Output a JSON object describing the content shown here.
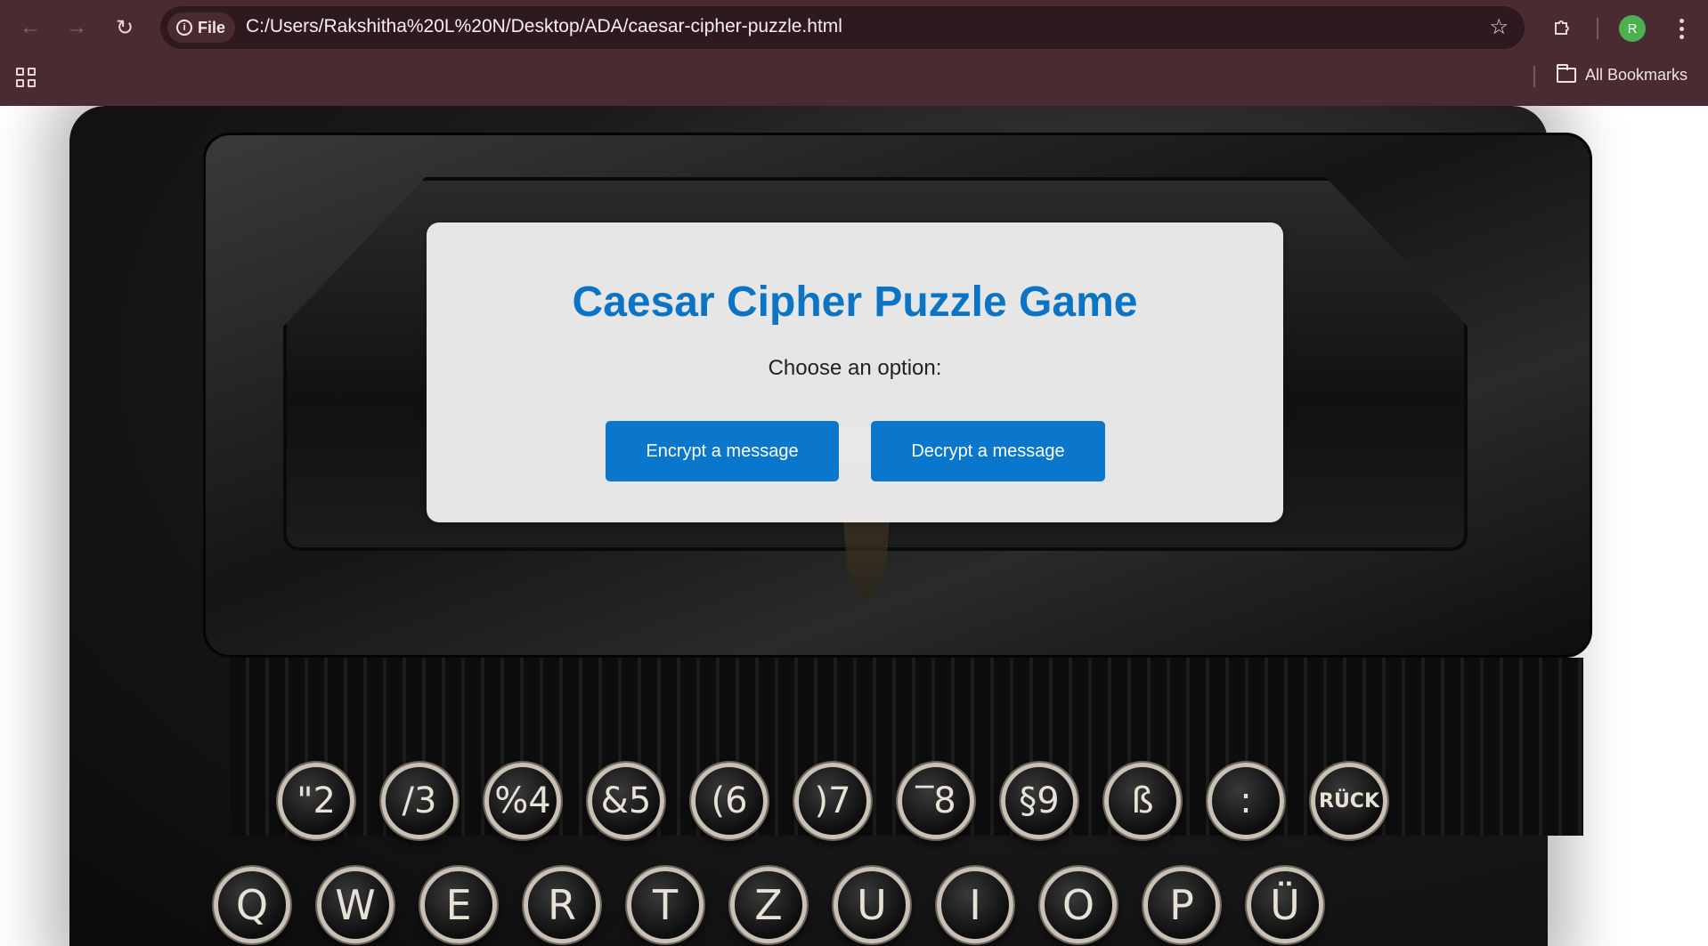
{
  "browser": {
    "site_chip": "File",
    "url": "C:/Users/Rakshitha%20L%20N/Desktop/ADA/caesar-cipher-puzzle.html",
    "profile_initial": "R",
    "all_bookmarks": "All Bookmarks",
    "icons": {
      "back": "back-arrow-icon",
      "forward": "forward-arrow-icon",
      "reload": "reload-icon",
      "info": "info-icon",
      "star": "star-icon",
      "extensions": "puzzle-piece-icon",
      "menu": "three-dot-menu-icon",
      "apps": "apps-grid-icon",
      "folder": "folder-icon"
    }
  },
  "colors": {
    "chrome": "#4a2b31",
    "omnibox": "#2e1a1e",
    "accent_blue": "#0b77cc",
    "title_blue": "#0b74c4",
    "avatar": "#4caf50"
  },
  "background_keys": {
    "row1": [
      "\"2",
      "/3",
      "%4",
      "&5",
      "(6",
      ")7",
      "‾8",
      "§9",
      "ß",
      ":",
      "RÜCK"
    ],
    "row2": [
      "Q",
      "W",
      "E",
      "R",
      "T",
      "Z",
      "U",
      "I",
      "O",
      "P",
      "Ü"
    ]
  },
  "game": {
    "title": "Caesar Cipher Puzzle Game",
    "prompt": "Choose an option:",
    "encrypt_label": "Encrypt a message",
    "decrypt_label": "Decrypt a message"
  }
}
